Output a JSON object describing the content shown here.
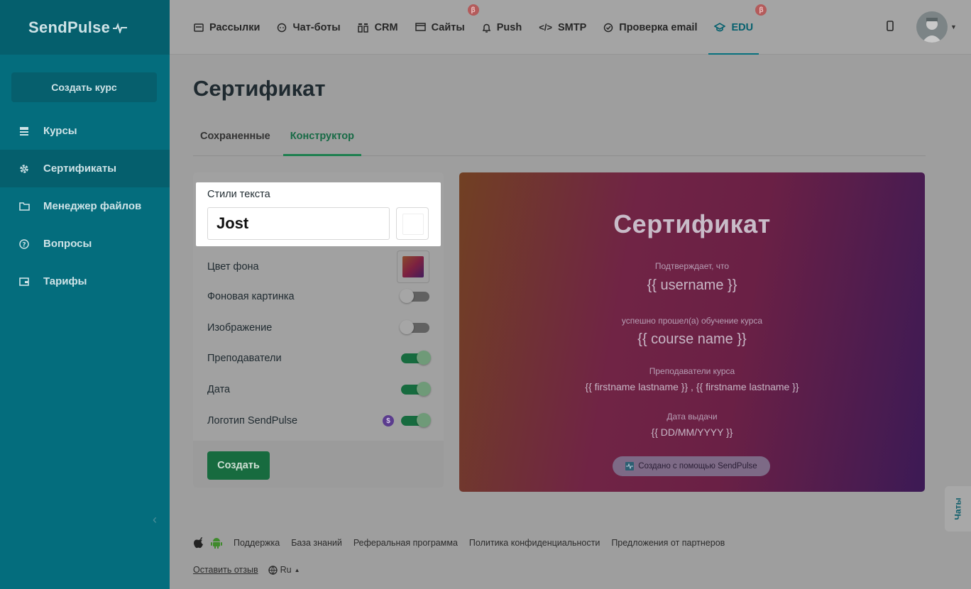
{
  "logo": {
    "text": "SendPulse"
  },
  "sidebar": {
    "create_label": "Создать курс",
    "items": [
      {
        "label": "Курсы",
        "icon": "courses-icon"
      },
      {
        "label": "Сертификаты",
        "icon": "gear-icon",
        "active": true
      },
      {
        "label": "Менеджер файлов",
        "icon": "folder-icon"
      },
      {
        "label": "Вопросы",
        "icon": "question-icon"
      },
      {
        "label": "Тарифы",
        "icon": "wallet-icon"
      }
    ]
  },
  "topnav": {
    "tabs": [
      {
        "label": "Рассылки",
        "icon": "mail-icon"
      },
      {
        "label": "Чат-боты",
        "icon": "chat-icon"
      },
      {
        "label": "CRM",
        "icon": "crm-icon"
      },
      {
        "label": "Сайты",
        "icon": "site-icon",
        "beta": "β"
      },
      {
        "label": "Push",
        "icon": "bell-icon"
      },
      {
        "label": "SMTP",
        "icon": "code-icon"
      },
      {
        "label": "Проверка email",
        "icon": "check-icon"
      },
      {
        "label": "EDU",
        "icon": "graduation-icon",
        "beta": "β",
        "active": true
      }
    ]
  },
  "page": {
    "title": "Сертификат",
    "subtabs": [
      {
        "label": "Сохраненные"
      },
      {
        "label": "Конструктор",
        "active": true
      }
    ]
  },
  "panel": {
    "text_styles_label": "Стили текста",
    "font_value": "Jost",
    "bg_color_label": "Цвет фона",
    "rows": [
      {
        "label": "Фоновая картинка",
        "on": false
      },
      {
        "label": "Изображение",
        "on": false
      },
      {
        "label": "Преподаватели",
        "on": true
      },
      {
        "label": "Дата",
        "on": true
      },
      {
        "label": "Логотип SendPulse",
        "on": true,
        "badge": "$"
      }
    ],
    "create_label": "Создать"
  },
  "certificate": {
    "title": "Сертификат",
    "confirms": "Подтверждает, что",
    "username": "{{ username }}",
    "completed": "успешно прошел(а) обучение курса",
    "course": "{{ course name }}",
    "teachers_label": "Преподаватели курса",
    "teachers": "{{ firstname lastname }} , {{ firstname lastname }}",
    "date_label": "Дата выдачи",
    "date": "{{ DD/MM/YYYY }}",
    "badge": "Создано с помощью SendPulse"
  },
  "chat_tab": {
    "label": "Чаты"
  },
  "footer": {
    "links": [
      "Поддержка",
      "База знаний",
      "Реферальная программа",
      "Политика конфиденциальности",
      "Предложения от партнеров"
    ],
    "review": "Оставить отзыв",
    "lang": "Ru"
  },
  "colors": {
    "sidebar": "#046d7d",
    "accent_green": "#176b3f",
    "edu_active": "#06606e"
  }
}
